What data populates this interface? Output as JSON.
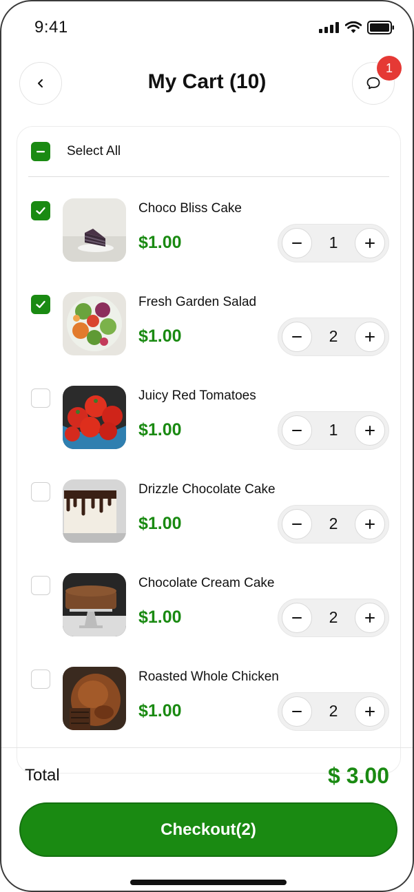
{
  "status_bar": {
    "time": "9:41",
    "icons": [
      "signal-icon",
      "wifi-icon",
      "battery-icon"
    ]
  },
  "header": {
    "title": "My Cart (10)",
    "back_icon": "chevron-left-icon",
    "chat_icon": "chat-bubble-icon",
    "chat_badge": "1"
  },
  "select_all": {
    "label": "Select All",
    "state": "indeterminate"
  },
  "items": [
    {
      "name": "Choco Bliss Cake",
      "price": "$1.00",
      "qty": "1",
      "checked": true
    },
    {
      "name": "Fresh Garden Salad",
      "price": "$1.00",
      "qty": "2",
      "checked": true
    },
    {
      "name": "Juicy Red Tomatoes",
      "price": "$1.00",
      "qty": "1",
      "checked": false
    },
    {
      "name": "Drizzle Chocolate Cake",
      "price": "$1.00",
      "qty": "2",
      "checked": false
    },
    {
      "name": "Chocolate Cream Cake",
      "price": "$1.00",
      "qty": "2",
      "checked": false
    },
    {
      "name": "Roasted Whole Chicken",
      "price": "$1.00",
      "qty": "2",
      "checked": false
    }
  ],
  "stepper": {
    "minus_symbol": "−",
    "plus_symbol": "+"
  },
  "footer": {
    "total_label": "Total",
    "total_value": "$ 3.00",
    "checkout_label": "Checkout(2)"
  },
  "colors": {
    "accent": "#1a8a12",
    "badge": "#e53935"
  }
}
